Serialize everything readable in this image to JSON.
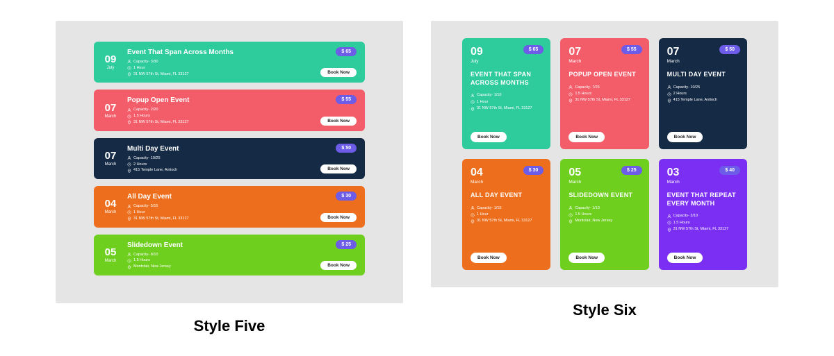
{
  "styleFive": {
    "caption": "Style Five",
    "events": [
      {
        "day": "09",
        "month": "July",
        "title": "Event That Span Across Months",
        "capacity": "Capacity- 3/30",
        "duration": "1 Hour",
        "location": "31 NW 57th St, Miami, FL 33127",
        "price": "$ 65",
        "book": "Book Now",
        "color": "#2ecb9c"
      },
      {
        "day": "07",
        "month": "March",
        "title": "Popup Open Event",
        "capacity": "Capacity- 2/20",
        "duration": "1.5 Hours",
        "location": "31 NW 57th St, Miami, FL 33127",
        "price": "$ 55",
        "book": "Book Now",
        "color": "#f35d6a"
      },
      {
        "day": "07",
        "month": "March",
        "title": "Multi Day Event",
        "capacity": "Capacity- 10/25",
        "duration": "2 Hours",
        "location": "415 Temple Lane, Antioch",
        "price": "$ 50",
        "book": "Book Now",
        "color": "#142a45"
      },
      {
        "day": "04",
        "month": "March",
        "title": "All Day Event",
        "capacity": "Capacity- 5/15",
        "duration": "1 Hour",
        "location": "31 NW 57th St, Miami, FL 33127",
        "price": "$ 30",
        "book": "Book Now",
        "color": "#ed6f1d"
      },
      {
        "day": "05",
        "month": "March",
        "title": "Slidedown Event",
        "capacity": "Capacity- 8/10",
        "duration": "1.5 Hours",
        "location": "Montclair, New Jersey",
        "price": "$ 25",
        "book": "Book Now",
        "color": "#6fcf1f"
      }
    ]
  },
  "styleSix": {
    "caption": "Style Six",
    "events": [
      {
        "day": "09",
        "month": "July",
        "title": "EVENT THAT SPAN ACROSS MONTHS",
        "capacity": "Capacity- 1/10",
        "duration": "1 Hour",
        "location": "31 NW 57th St, Miami, FL 33127",
        "price": "$ 65",
        "book": "Book Now",
        "color": "#2ecb9c"
      },
      {
        "day": "07",
        "month": "March",
        "title": "POPUP OPEN EVENT",
        "capacity": "Capacity- 7/26",
        "duration": "1.5 Hours",
        "location": "31 NW 57th St, Miami, FL 33127",
        "price": "$ 55",
        "book": "Book Now",
        "color": "#f35d6a"
      },
      {
        "day": "07",
        "month": "March",
        "title": "MULTI DAY EVENT",
        "capacity": "Capacity- 10/25",
        "duration": "2 Hours",
        "location": "415 Temple Lane, Antioch",
        "price": "$ 50",
        "book": "Book Now",
        "color": "#142a45"
      },
      {
        "day": "04",
        "month": "March",
        "title": "ALL DAY EVENT",
        "capacity": "Capacity- 1/15",
        "duration": "1 Hour",
        "location": "31 NW 57th St, Miami, FL 33127",
        "price": "$ 30",
        "book": "Book Now",
        "color": "#ed6f1d"
      },
      {
        "day": "05",
        "month": "March",
        "title": "SLIDEDOWN EVENT",
        "capacity": "Capacity- 1/10",
        "duration": "1.5 Hours",
        "location": "Montclair, New Jersey",
        "price": "$ 25",
        "book": "Book Now",
        "color": "#6fcf1f"
      },
      {
        "day": "03",
        "month": "March",
        "title": "EVENT THAT REPEAT EVERY MONTH",
        "capacity": "Capacity- 3/10",
        "duration": "1.5 Hours",
        "location": "31 NW 57th St, Miami, FL 33127",
        "price": "$ 40",
        "book": "Book Now",
        "color": "#7b2ff2"
      }
    ]
  }
}
